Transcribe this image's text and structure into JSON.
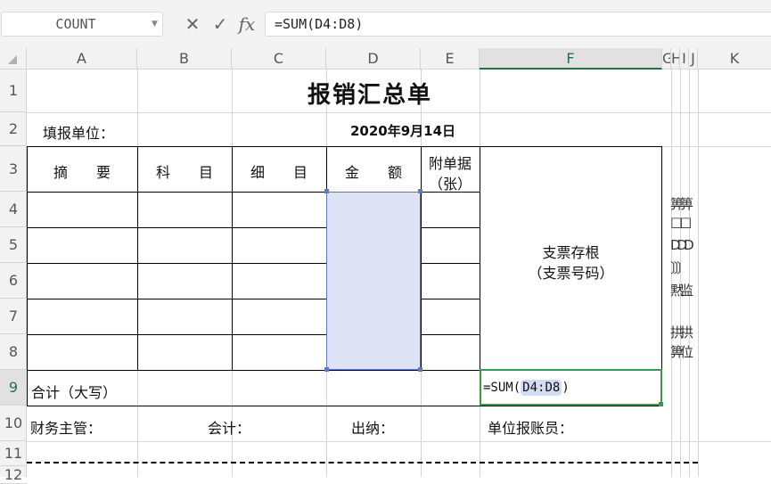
{
  "formula_bar": {
    "name_box": "COUNT",
    "cancel_icon": "✕",
    "enter_icon": "✓",
    "fx_icon": "fx",
    "formula": "=SUM(D4:D8)"
  },
  "columns": [
    "A",
    "B",
    "C",
    "D",
    "E",
    "F",
    "G",
    "H",
    "I",
    "J",
    "K"
  ],
  "rows": [
    "1",
    "2",
    "3",
    "4",
    "5",
    "6",
    "7",
    "8",
    "9",
    "10",
    "11",
    "12"
  ],
  "sheet": {
    "title": "报销汇总单",
    "fill_unit_label": "填报单位：",
    "date": "2020年9月14日",
    "headers": {
      "summary": "摘　　要",
      "subject": "科　　目",
      "detail": "细　　目",
      "amount": "金　　额",
      "attachments_line1": "附单据",
      "attachments_line2": "（张）"
    },
    "stub_line1": "支票存根",
    "stub_line2": "（支票号码）",
    "total_label": "合计（大写）",
    "active_formula_prefix": "=SUM(",
    "active_formula_ref": "D4:D8",
    "active_formula_suffix": ")",
    "finance_supervisor": "财务主管：",
    "accountant": "会计：",
    "cashier": "出纳：",
    "claimant": "单位报账员：",
    "overflow_text": [
      "箅箅",
      "□□",
      "DDD",
      "〕〕〕",
      "黙监",
      "拱拱",
      "箅位"
    ]
  },
  "colors": {
    "selection_fill": "#dde3f5",
    "selection_border": "#5a7ac6",
    "active_border": "#3a9a4c"
  }
}
